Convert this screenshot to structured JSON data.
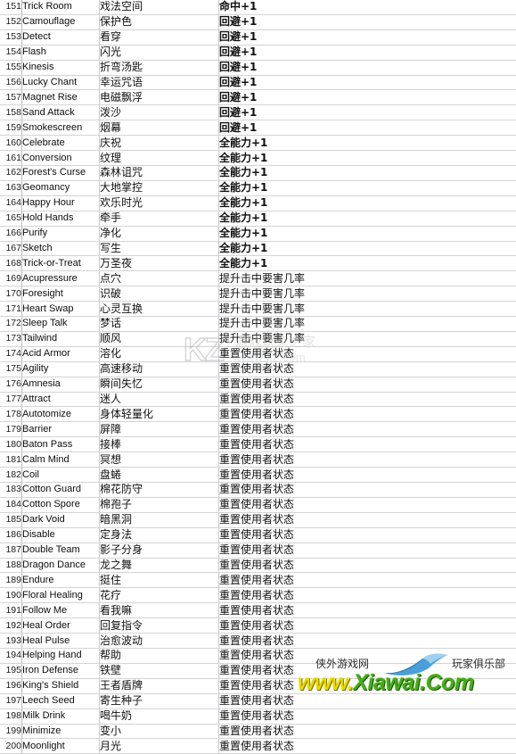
{
  "document": {
    "type": "spreadsheet-table",
    "columns": [
      "",
      "",
      "",
      ""
    ],
    "first_row_number": 151,
    "last_row_number": 200
  },
  "watermark_center": {
    "logo_text": "KZ",
    "chinese": "游戏玩家之家",
    "url": "www.kz.com"
  },
  "watermark_bottom_right": {
    "site_name_left": "侠外游戏网",
    "site_name_right": "玩家俱乐部",
    "url_part1": "www.",
    "url_part2": "Xiawai.",
    "url_part3": "Com"
  },
  "rows": [
    {
      "n": "151",
      "en": "Trick Room",
      "cn": "戏法空间",
      "ef": "命中+1",
      "b": true
    },
    {
      "n": "152",
      "en": "Camouflage",
      "cn": "保护色",
      "ef": "回避+1",
      "b": true
    },
    {
      "n": "153",
      "en": "Detect",
      "cn": "看穿",
      "ef": "回避+1",
      "b": true
    },
    {
      "n": "154",
      "en": "Flash",
      "cn": "闪光",
      "ef": "回避+1",
      "b": true
    },
    {
      "n": "155",
      "en": "Kinesis",
      "cn": "折弯汤匙",
      "ef": "回避+1",
      "b": true
    },
    {
      "n": "156",
      "en": "Lucky Chant",
      "cn": "幸运咒语",
      "ef": "回避+1",
      "b": true
    },
    {
      "n": "157",
      "en": "Magnet Rise",
      "cn": "电磁飘浮",
      "ef": "回避+1",
      "b": true
    },
    {
      "n": "158",
      "en": "Sand Attack",
      "cn": "泼沙",
      "ef": "回避+1",
      "b": true
    },
    {
      "n": "159",
      "en": "Smokescreen",
      "cn": "烟幕",
      "ef": "回避+1",
      "b": true
    },
    {
      "n": "160",
      "en": "Celebrate",
      "cn": "庆祝",
      "ef": "全能力+1",
      "b": true
    },
    {
      "n": "161",
      "en": "Conversion",
      "cn": "纹理",
      "ef": "全能力+1",
      "b": true
    },
    {
      "n": "162",
      "en": "Forest's Curse",
      "cn": "森林诅咒",
      "ef": "全能力+1",
      "b": true
    },
    {
      "n": "163",
      "en": "Geomancy",
      "cn": "大地掌控",
      "ef": "全能力+1",
      "b": true
    },
    {
      "n": "164",
      "en": "Happy Hour",
      "cn": "欢乐时光",
      "ef": "全能力+1",
      "b": true
    },
    {
      "n": "165",
      "en": "Hold Hands",
      "cn": "牵手",
      "ef": "全能力+1",
      "b": true
    },
    {
      "n": "166",
      "en": "Purify",
      "cn": "净化",
      "ef": "全能力+1",
      "b": true
    },
    {
      "n": "167",
      "en": "Sketch",
      "cn": "写生",
      "ef": "全能力+1",
      "b": true
    },
    {
      "n": "168",
      "en": "Trick-or-Treat",
      "cn": "万圣夜",
      "ef": "全能力+1",
      "b": true
    },
    {
      "n": "169",
      "en": "Acupressure",
      "cn": "点穴",
      "ef": "提升击中要害几率",
      "b": false
    },
    {
      "n": "170",
      "en": "Foresight",
      "cn": "识破",
      "ef": "提升击中要害几率",
      "b": false
    },
    {
      "n": "171",
      "en": "Heart Swap",
      "cn": "心灵互换",
      "ef": "提升击中要害几率",
      "b": false
    },
    {
      "n": "172",
      "en": "Sleep Talk",
      "cn": "梦话",
      "ef": "提升击中要害几率",
      "b": false
    },
    {
      "n": "173",
      "en": "Tailwind",
      "cn": "顺风",
      "ef": "提升击中要害几率",
      "b": false
    },
    {
      "n": "174",
      "en": "Acid Armor",
      "cn": "溶化",
      "ef": "重置使用者状态",
      "b": false
    },
    {
      "n": "175",
      "en": "Agility",
      "cn": "高速移动",
      "ef": "重置使用者状态",
      "b": false
    },
    {
      "n": "176",
      "en": "Amnesia",
      "cn": "瞬间失忆",
      "ef": "重置使用者状态",
      "b": false
    },
    {
      "n": "177",
      "en": "Attract",
      "cn": "迷人",
      "ef": "重置使用者状态",
      "b": false
    },
    {
      "n": "178",
      "en": "Autotomize",
      "cn": "身体轻量化",
      "ef": "重置使用者状态",
      "b": false
    },
    {
      "n": "179",
      "en": "Barrier",
      "cn": "屏障",
      "ef": "重置使用者状态",
      "b": false
    },
    {
      "n": "180",
      "en": "Baton Pass",
      "cn": "接棒",
      "ef": "重置使用者状态",
      "b": false
    },
    {
      "n": "181",
      "en": "Calm Mind",
      "cn": "冥想",
      "ef": "重置使用者状态",
      "b": false
    },
    {
      "n": "182",
      "en": "Coil",
      "cn": "盘蜷",
      "ef": "重置使用者状态",
      "b": false
    },
    {
      "n": "183",
      "en": "Cotton Guard",
      "cn": "棉花防守",
      "ef": "重置使用者状态",
      "b": false
    },
    {
      "n": "184",
      "en": "Cotton Spore",
      "cn": "棉孢子",
      "ef": "重置使用者状态",
      "b": false
    },
    {
      "n": "185",
      "en": "Dark Void",
      "cn": "暗黑洞",
      "ef": "重置使用者状态",
      "b": false
    },
    {
      "n": "186",
      "en": "Disable",
      "cn": "定身法",
      "ef": "重置使用者状态",
      "b": false
    },
    {
      "n": "187",
      "en": "Double Team",
      "cn": "影子分身",
      "ef": "重置使用者状态",
      "b": false
    },
    {
      "n": "188",
      "en": "Dragon Dance",
      "cn": "龙之舞",
      "ef": "重置使用者状态",
      "b": false
    },
    {
      "n": "189",
      "en": "Endure",
      "cn": "挺住",
      "ef": "重置使用者状态",
      "b": false
    },
    {
      "n": "190",
      "en": "Floral Healing",
      "cn": "花疗",
      "ef": "重置使用者状态",
      "b": false
    },
    {
      "n": "191",
      "en": "Follow Me",
      "cn": "看我嘛",
      "ef": "重置使用者状态",
      "b": false
    },
    {
      "n": "192",
      "en": "Heal Order",
      "cn": "回复指令",
      "ef": "重置使用者状态",
      "b": false
    },
    {
      "n": "193",
      "en": "Heal Pulse",
      "cn": "治愈波动",
      "ef": "重置使用者状态",
      "b": false
    },
    {
      "n": "194",
      "en": "Helping Hand",
      "cn": "帮助",
      "ef": "重置使用者状态",
      "b": false
    },
    {
      "n": "195",
      "en": "Iron Defense",
      "cn": "铁壁",
      "ef": "重置使用者状态",
      "b": false
    },
    {
      "n": "196",
      "en": "King's Shield",
      "cn": "王者盾牌",
      "ef": "重置使用者状态",
      "b": false
    },
    {
      "n": "197",
      "en": "Leech Seed",
      "cn": "寄生种子",
      "ef": "重置使用者状态",
      "b": false
    },
    {
      "n": "198",
      "en": "Milk Drink",
      "cn": "喝牛奶",
      "ef": "重置使用者状态",
      "b": false
    },
    {
      "n": "199",
      "en": "Minimize",
      "cn": "变小",
      "ef": "重置使用者状态",
      "b": false
    },
    {
      "n": "200",
      "en": "Moonlight",
      "cn": "月光",
      "ef": "重置使用者状态",
      "b": false
    }
  ]
}
